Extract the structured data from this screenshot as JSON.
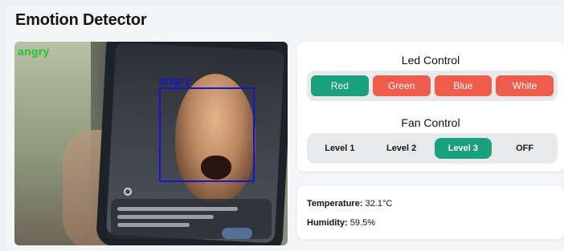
{
  "app": {
    "title": "Emotion Detector"
  },
  "video": {
    "frame_label": "angry",
    "face_label": "angry"
  },
  "led": {
    "title": "Led Control",
    "buttons": [
      {
        "label": "Red",
        "active": true
      },
      {
        "label": "Green",
        "active": false
      },
      {
        "label": "Blue",
        "active": false
      },
      {
        "label": "White",
        "active": false
      }
    ]
  },
  "fan": {
    "title": "Fan Control",
    "buttons": [
      {
        "label": "Level 1",
        "active": false
      },
      {
        "label": "Level 2",
        "active": false
      },
      {
        "label": "Level 3",
        "active": true
      },
      {
        "label": "OFF",
        "active": false
      }
    ]
  },
  "sensors": {
    "temperature_label": "Temperature:",
    "temperature_value": "32.1°C",
    "humidity_label": "Humidity:",
    "humidity_value": "59.5%"
  },
  "colors": {
    "active": "#1aa07a",
    "led_inactive": "#ee5c4b",
    "frame_label": "#27c427",
    "face_box": "#1616c8"
  }
}
